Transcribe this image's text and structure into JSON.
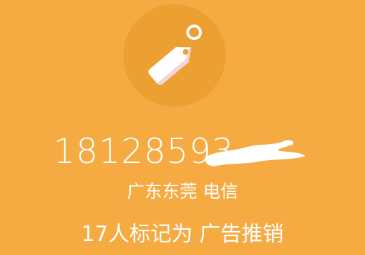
{
  "caller": {
    "tag_icon": "price-tag-icon",
    "phone_number": "1812859",
    "phone_partial_digit": "3",
    "location": "广东东莞 电信",
    "mark_label": "17人标记为 广告推销"
  },
  "colors": {
    "background": "#F5AB42",
    "icon_circle": "#EDA032",
    "text": "#FFFFFF"
  }
}
